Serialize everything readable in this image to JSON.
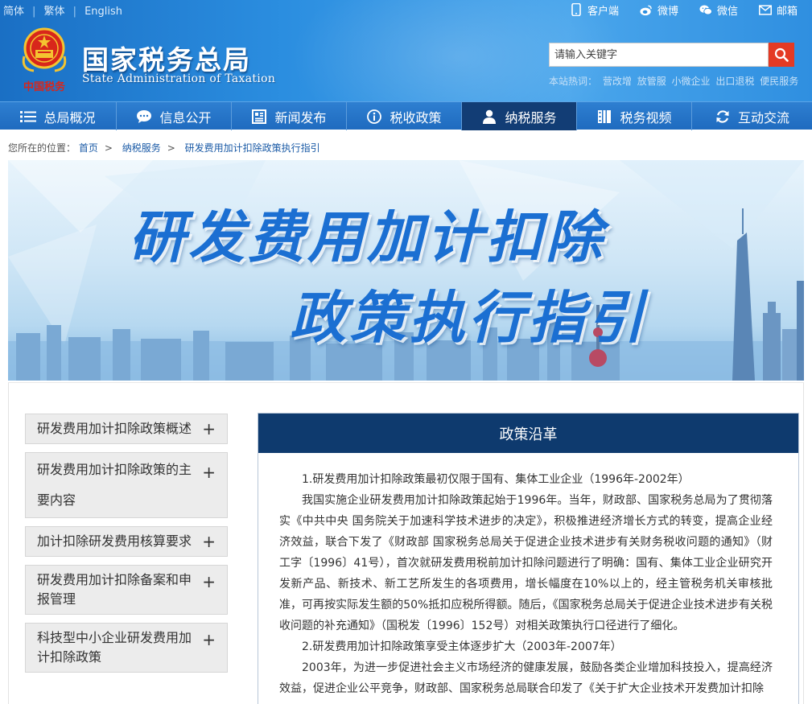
{
  "header": {
    "lang": [
      "简体",
      "繁体",
      "English"
    ],
    "top_links": [
      {
        "label": "客户端",
        "icon": "mobile-icon"
      },
      {
        "label": "微博",
        "icon": "weibo-icon"
      },
      {
        "label": "微信",
        "icon": "wechat-icon"
      },
      {
        "label": "邮箱",
        "icon": "mail-icon"
      }
    ],
    "logo_cn": "国家税务总局",
    "logo_en": "State Administration of Taxation",
    "emblem_text": "中国税务",
    "search_placeholder": "请输入关键字",
    "hot_label": "本站热词：",
    "hot_words": [
      "营改增",
      "放管服",
      "小微企业",
      "出口退税",
      "便民服务"
    ]
  },
  "nav": {
    "items": [
      {
        "label": "总局概况",
        "icon": "menu-icon"
      },
      {
        "label": "信息公开",
        "icon": "chat-icon"
      },
      {
        "label": "新闻发布",
        "icon": "news-icon"
      },
      {
        "label": "税收政策",
        "icon": "info-icon"
      },
      {
        "label": "纳税服务",
        "icon": "person-icon"
      },
      {
        "label": "税务视频",
        "icon": "video-icon"
      },
      {
        "label": "互动交流",
        "icon": "refresh-icon"
      }
    ],
    "active_index": 4
  },
  "breadcrumb": {
    "prefix": "您所在的位置：",
    "items": [
      "首页",
      "纳税服务",
      "研发费用加计扣除政策执行指引"
    ]
  },
  "banner": {
    "line1": "研发费用加计扣除",
    "line2": "政策执行指引"
  },
  "sidebar": {
    "items": [
      "研发费用加计扣除政策概述",
      "研发费用加计扣除政策的主要内容",
      "加计扣除研发费用核算要求",
      "研发费用加计扣除备案和申报管理",
      "科技型中小企业研发费用加计扣除政策"
    ]
  },
  "panel": {
    "title": "政策沿革",
    "paragraphs": [
      "1.研发费用加计扣除政策最初仅限于国有、集体工业企业（1996年-2002年）",
      "我国实施企业研发费用加计扣除政策起始于1996年。当年，财政部、国家税务总局为了贯彻落实《中共中央 国务院关于加速科学技术进步的决定》，积极推进经济增长方式的转变，提高企业经济效益，联合下发了《财政部 国家税务总局关于促进企业技术进步有关财务税收问题的通知》（财工字〔1996〕41号），首次就研发费用税前加计扣除问题进行了明确：国有、集体工业企业研究开发新产品、新技术、新工艺所发生的各项费用，增长幅度在10%以上的，经主管税务机关审核批准，可再按实际发生额的50%抵扣应税所得额。随后，《国家税务总局关于促进企业技术进步有关税收问题的补充通知》（国税发〔1996〕152号）对相关政策执行口径进行了细化。",
      "2.研发费用加计扣除政策享受主体逐步扩大（2003年-2007年）",
      "2003年，为进一步促进社会主义市场经济的健康发展，鼓励各类企业增加科技投入，提高经济效益，促进企业公平竞争，财政部、国家税务总局联合印发了《关于扩大企业技术开发费加计扣除"
    ]
  },
  "colors": {
    "header_blue": "#1a6fc4",
    "nav_active": "#123d75",
    "panel_head": "#0e3a6e",
    "search_button": "#e43a24"
  }
}
